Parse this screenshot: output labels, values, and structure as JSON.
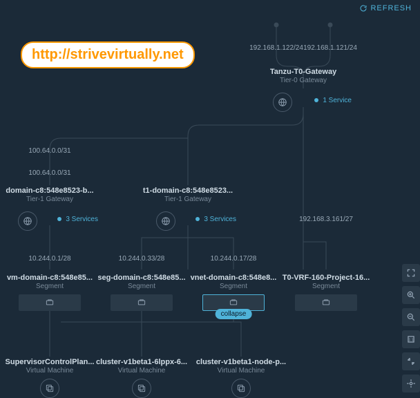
{
  "refresh_label": "REFRESH",
  "watermark": "http://strivevirtually.net",
  "collapse_label": "collapse",
  "uplinks": {
    "left": "192.168.1.122/24",
    "right": "192.168.1.121/24"
  },
  "t0": {
    "title": "Tanzu-T0-Gateway",
    "subtitle": "Tier-0 Gateway",
    "services": "1 Service"
  },
  "t1_left": {
    "title": "domain-c8:548e8523-b...",
    "subtitle": "Tier-1 Gateway",
    "services": "3 Services",
    "cidr1": "100.64.0.0/31",
    "cidr2": "100.64.0.0/31"
  },
  "t1_mid": {
    "title": "t1-domain-c8:548e8523...",
    "subtitle": "Tier-1 Gateway",
    "services": "3 Services"
  },
  "t0_vrf_cidr": "192.168.3.161/27",
  "segments": {
    "vm": {
      "title": "vm-domain-c8:548e85...",
      "subtitle": "Segment",
      "cidr": "10.244.0.1/28"
    },
    "seg": {
      "title": "seg-domain-c8:548e85...",
      "subtitle": "Segment",
      "cidr": "10.244.0.33/28"
    },
    "vnet": {
      "title": "vnet-domain-c8:548e8...",
      "subtitle": "Segment",
      "cidr": "10.244.0.17/28"
    },
    "vrf": {
      "title": "T0-VRF-160-Project-16...",
      "subtitle": "Segment"
    }
  },
  "vms": {
    "scp": {
      "title": "SupervisorControlPlan...",
      "subtitle": "Virtual Machine"
    },
    "c1": {
      "title": "cluster-v1beta1-6lppx-6...",
      "subtitle": "Virtual Machine"
    },
    "c2": {
      "title": "cluster-v1beta1-node-p...",
      "subtitle": "Virtual Machine"
    }
  }
}
